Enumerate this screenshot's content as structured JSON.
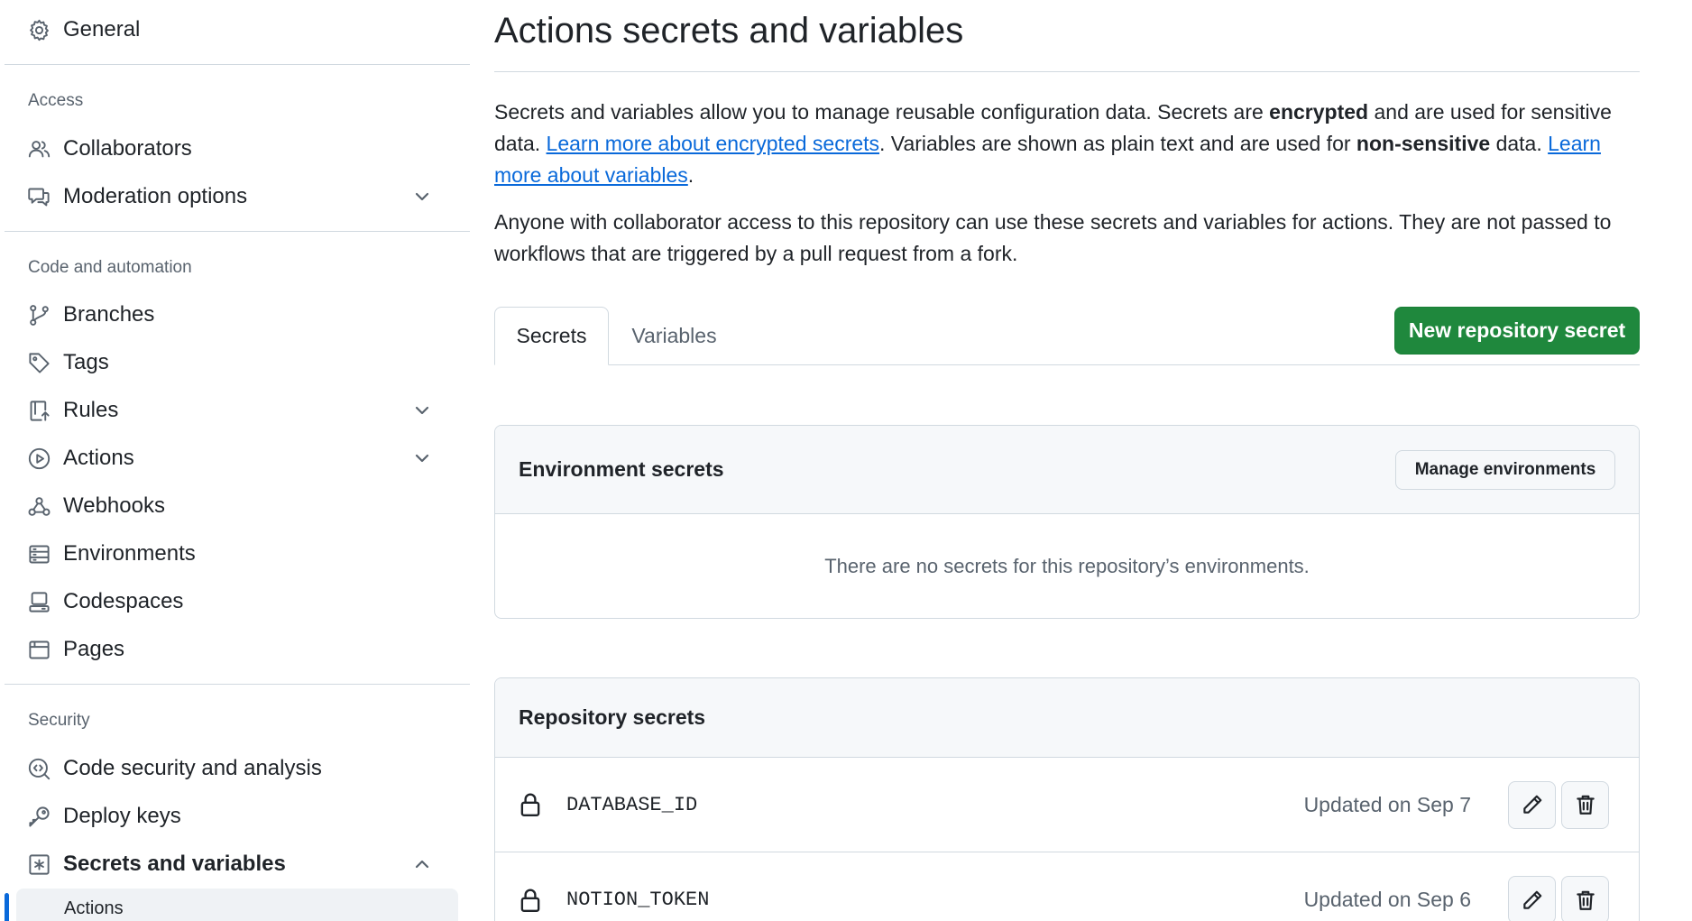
{
  "sidebar": {
    "general": "General",
    "access_heading": "Access",
    "collaborators": "Collaborators",
    "moderation": "Moderation options",
    "code_heading": "Code and automation",
    "branches": "Branches",
    "tags": "Tags",
    "rules": "Rules",
    "actions": "Actions",
    "webhooks": "Webhooks",
    "environments": "Environments",
    "codespaces": "Codespaces",
    "pages": "Pages",
    "security_heading": "Security",
    "code_security": "Code security and analysis",
    "deploy_keys": "Deploy keys",
    "secrets_vars": "Secrets and variables",
    "sub_actions": "Actions"
  },
  "main": {
    "title": "Actions secrets and variables",
    "intro": {
      "p1_a": "Secrets and variables allow you to manage reusable configuration data. Secrets are ",
      "p1_b": "encrypted",
      "p1_c": " and are used for sensitive data. ",
      "link1": "Learn more about encrypted secrets",
      "p1_d": ". Variables are shown as plain text and are used for ",
      "p1_e": "non-sensitive",
      "p1_f": " data. ",
      "link2": "Learn more about variables",
      "p1_g": ".",
      "p2": "Anyone with collaborator access to this repository can use these secrets and variables for actions. They are not passed to workflows that are triggered by a pull request from a fork."
    },
    "tabs": [
      "Secrets",
      "Variables"
    ],
    "new_secret_button": "New repository secret",
    "environment_secrets": {
      "heading": "Environment secrets",
      "manage_button": "Manage environments",
      "empty": "There are no secrets for this repository’s environments."
    },
    "repository_secrets": {
      "heading": "Repository secrets",
      "rows": [
        {
          "name": "DATABASE_ID",
          "updated": "Updated on Sep 7"
        },
        {
          "name": "NOTION_TOKEN",
          "updated": "Updated on Sep 6"
        }
      ]
    }
  },
  "colors": {
    "primary_button": "#1f883d",
    "link": "#0969da",
    "active_indicator": "#0969da"
  }
}
